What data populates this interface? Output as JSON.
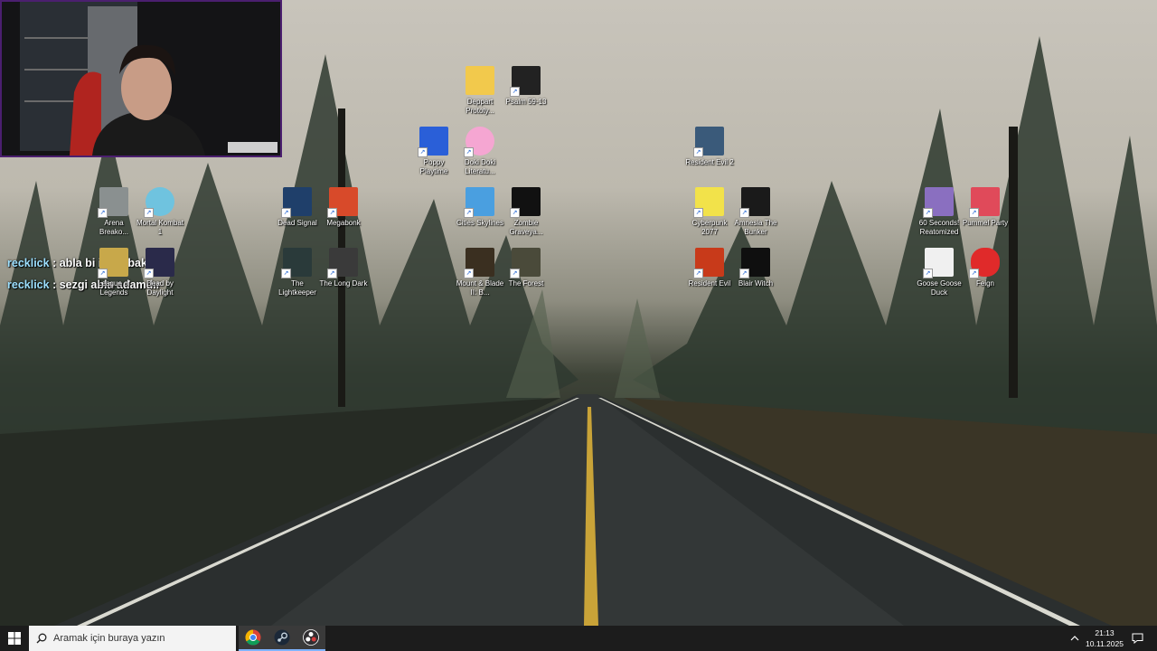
{
  "chat": [
    {
      "user": "recklick",
      "message": ": abla bi insta baksana"
    },
    {
      "user": "recklick",
      "message": ": sezgi abla adamdır"
    }
  ],
  "desktop_icons": [
    {
      "label": "Deppart Prototy...",
      "icon": "folder-icon",
      "color": "#f2c94c"
    },
    {
      "label": "Psalm 59-13",
      "icon": "psalm-icon",
      "color": "#222222"
    },
    {
      "label": "Poppy Playtime",
      "icon": "poppy-playtime-icon",
      "color": "#2a5fd8"
    },
    {
      "label": "Doki Doki Literatu...",
      "icon": "doki-doki-icon",
      "color": "#f5a6d2"
    },
    {
      "label": "Resident Evil 2",
      "icon": "resident-evil-2-icon",
      "color": "#3a5a7a"
    },
    {
      "label": "Arena Breako...",
      "icon": "arena-breakout-icon",
      "color": "#8a9090"
    },
    {
      "label": "Mortal Kombat 1",
      "icon": "mortal-kombat-icon",
      "color": "#6fc3df"
    },
    {
      "label": "Dead Signal",
      "icon": "dead-signal-icon",
      "color": "#1f3f6a"
    },
    {
      "label": "Megabonk",
      "icon": "megabonk-icon",
      "color": "#d84a2a"
    },
    {
      "label": "Cities Skylines",
      "icon": "cities-skylines-icon",
      "color": "#4a9fe0"
    },
    {
      "label": "Zombie Graveya...",
      "icon": "zombie-graveyard-icon",
      "color": "#111111"
    },
    {
      "label": "Cyberpunk 2077",
      "icon": "cyberpunk-icon",
      "color": "#f2e24a"
    },
    {
      "label": "Amnesia The Bunker",
      "icon": "amnesia-icon",
      "color": "#1a1a1a"
    },
    {
      "label": "60 Seconds! Reatomized",
      "icon": "sixty-seconds-icon",
      "color": "#8a6fc0"
    },
    {
      "label": "Pummel Party",
      "icon": "pummel-party-icon",
      "color": "#e04a5a"
    },
    {
      "label": "League of Legends",
      "icon": "league-icon",
      "color": "#c8a84a"
    },
    {
      "label": "Dead by Daylight",
      "icon": "dead-by-daylight-icon",
      "color": "#2a2a4a"
    },
    {
      "label": "The Lightkeeper",
      "icon": "lightkeeper-icon",
      "color": "#2a3a3a"
    },
    {
      "label": "The Long Dark",
      "icon": "long-dark-icon",
      "color": "#3a3a3a"
    },
    {
      "label": "Mount & Blade II: B...",
      "icon": "mount-blade-icon",
      "color": "#3a2f20"
    },
    {
      "label": "The Forest",
      "icon": "the-forest-icon",
      "color": "#4a4a3a"
    },
    {
      "label": "Resident Evil",
      "icon": "resident-evil-icon",
      "color": "#c83a1a"
    },
    {
      "label": "Blair Witch",
      "icon": "blair-witch-icon",
      "color": "#0f0f0f"
    },
    {
      "label": "Goose Goose Duck",
      "icon": "goose-goose-duck-icon",
      "color": "#f0f0f0"
    },
    {
      "label": "Feign",
      "icon": "feign-icon",
      "color": "#e02a2a"
    }
  ],
  "taskbar": {
    "search_placeholder": "Aramak için buraya yazın",
    "time": "21:13",
    "date": "10.11.2025",
    "apps": [
      "chrome-icon",
      "steam-icon",
      "obs-icon"
    ]
  }
}
